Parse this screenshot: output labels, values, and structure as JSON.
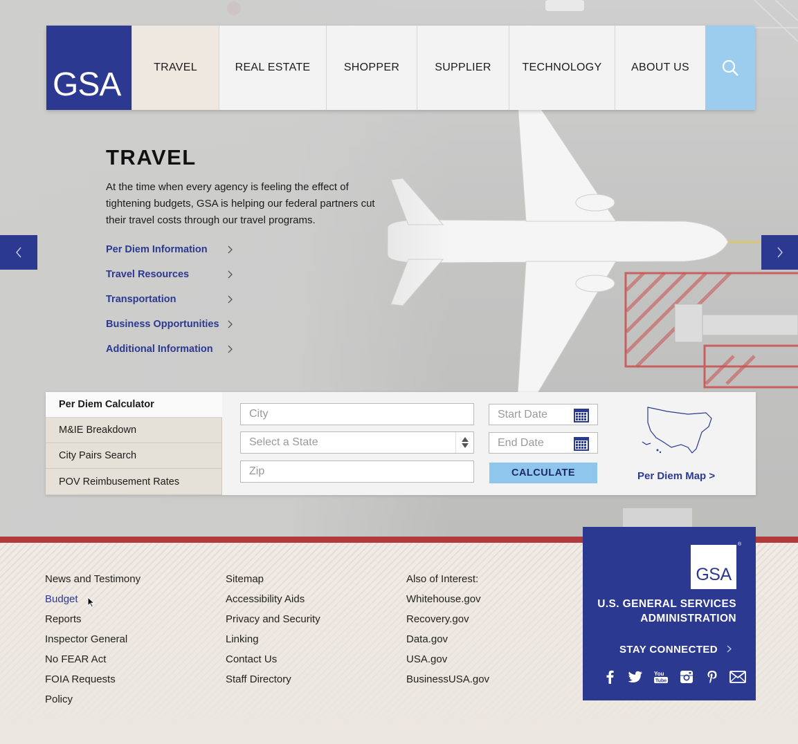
{
  "nav": {
    "logo": "GSA",
    "items": [
      {
        "label": "TRAVEL",
        "active": true
      },
      {
        "label": "REAL ESTATE"
      },
      {
        "label": "SHOPPER"
      },
      {
        "label": "SUPPLIER"
      },
      {
        "label": "TECHNOLOGY"
      },
      {
        "label": "ABOUT US"
      }
    ],
    "search_icon": "search-icon"
  },
  "hero": {
    "title": "TRAVEL",
    "description": "At the time when every agency is feeling the effect of tightening budgets, GSA is helping our federal partners cut their travel costs through our travel programs.",
    "links": [
      "Per Diem Information",
      "Travel Resources",
      "Transportation",
      "Business Opportunities",
      "Additional Information"
    ]
  },
  "calculator": {
    "tabs": [
      "Per Diem Calculator",
      "M&IE Breakdown",
      "City Pairs Search",
      "POV Reimbusement Rates"
    ],
    "city_placeholder": "City",
    "state_placeholder": "Select a State",
    "zip_placeholder": "Zip",
    "start_date_placeholder": "Start Date",
    "end_date_placeholder": "End Date",
    "calculate_label": "CALCULATE",
    "map_link": "Per Diem Map >"
  },
  "footer": {
    "col1": [
      "News and Testimony",
      "Budget",
      "Reports",
      "Inspector General",
      "No FEAR Act",
      "FOIA Requests",
      "Policy"
    ],
    "col2": [
      "Sitemap",
      "Accessibility Aids",
      "Privacy and Security",
      "Linking",
      "Contact Us",
      "Staff Directory"
    ],
    "col3": [
      "Also of Interest:",
      "Whitehouse.gov",
      "Recovery.gov",
      "Data.gov",
      "USA.gov",
      "BusinessUSA.gov"
    ],
    "card": {
      "logo": "GSA",
      "registered": "®",
      "name_line1": "U.S. GENERAL SERVICES",
      "name_line2": "ADMINISTRATION",
      "stay_connected": "STAY CONNECTED",
      "social_icons": [
        "facebook-icon",
        "twitter-icon",
        "youtube-icon",
        "instagram-icon",
        "pinterest-icon",
        "email-icon"
      ]
    }
  },
  "colors": {
    "brand_blue": "#2b3990",
    "search_blue": "#9dcdee",
    "button_blue": "#8ec6ee",
    "footer_red": "#b23a3c"
  }
}
